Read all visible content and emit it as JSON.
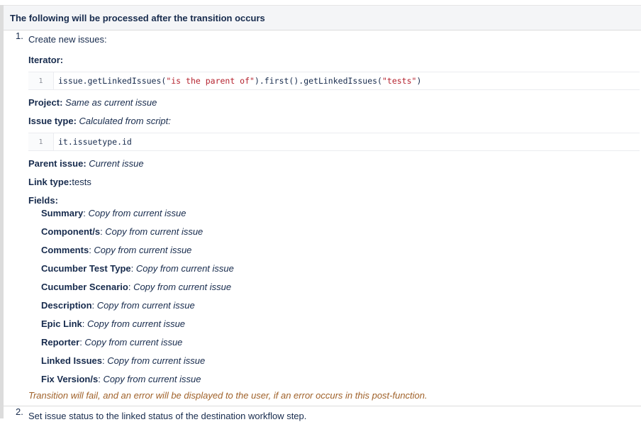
{
  "header": {
    "title": "The following will be processed after the transition occurs"
  },
  "step1": {
    "number": "1.",
    "title": "Create new issues:",
    "iterator_label": "Iterator:",
    "iterator_code": {
      "line_no": "1",
      "prefix": "issue.getLinkedIssues(",
      "arg1": "\"is the parent of\"",
      "middle": ").first().getLinkedIssues(",
      "arg2": "\"tests\"",
      "suffix": ")"
    },
    "project_label": "Project:",
    "project_value": "Same as current issue",
    "issue_type_label": "Issue type:",
    "issue_type_value": "Calculated from script:",
    "issue_type_code": {
      "line_no": "1",
      "text": "it.issuetype.id"
    },
    "parent_label": "Parent issue:",
    "parent_value": "Current issue",
    "link_type_label": "Link type:",
    "link_type_value": "tests",
    "fields_label": "Fields:",
    "fields": [
      {
        "name": "Summary",
        "value": "Copy from current issue"
      },
      {
        "name": "Component/s",
        "value": "Copy from current issue"
      },
      {
        "name": "Comments",
        "value": "Copy from current issue"
      },
      {
        "name": "Cucumber Test Type",
        "value": "Copy from current issue"
      },
      {
        "name": "Cucumber Scenario",
        "value": "Copy from current issue"
      },
      {
        "name": "Description",
        "value": "Copy from current issue"
      },
      {
        "name": "Epic Link",
        "value": "Copy from current issue"
      },
      {
        "name": "Reporter",
        "value": "Copy from current issue"
      },
      {
        "name": "Linked Issues",
        "value": "Copy from current issue"
      },
      {
        "name": "Fix Version/s",
        "value": "Copy from current issue"
      }
    ],
    "warning": "Transition will fail, and an error will be displayed to the user, if an error occurs in this post-function."
  },
  "step2": {
    "number": "2.",
    "title": "Set issue status to the linked status of the destination workflow step."
  },
  "colors": {
    "warning": "#a0622a",
    "string": "#b5232f",
    "header_bg": "#f4f5f7"
  }
}
